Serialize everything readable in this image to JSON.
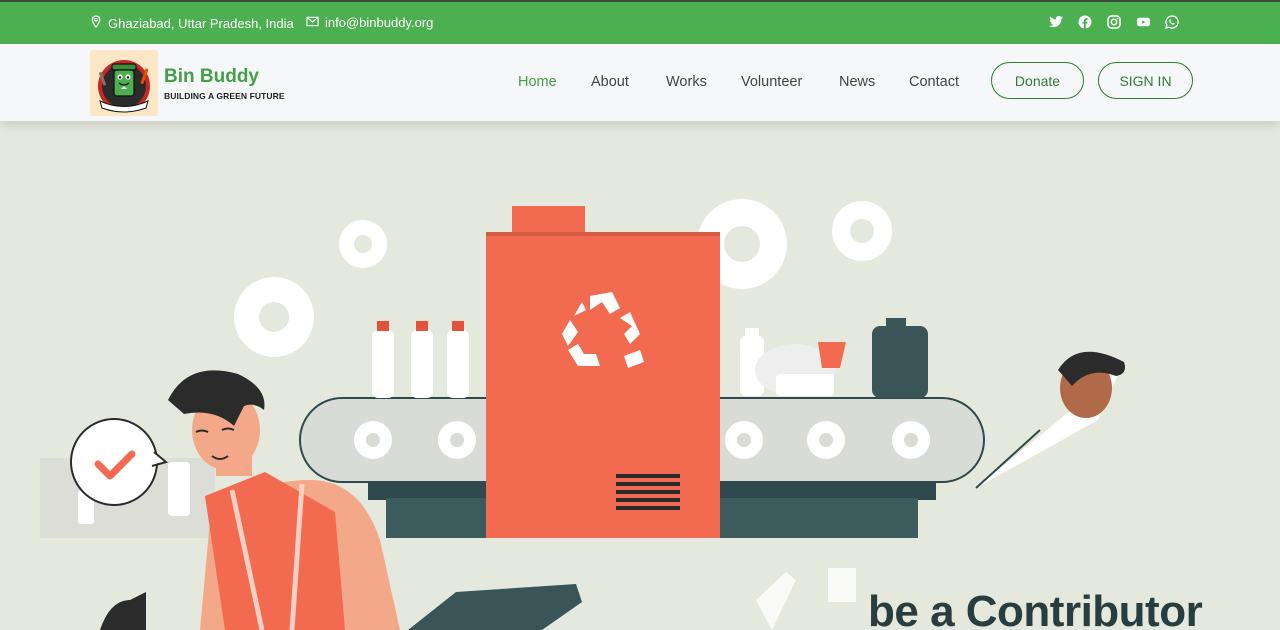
{
  "topbar": {
    "location": "Ghaziabad, Uttar Pradesh, India",
    "email": "info@binbuddy.org",
    "socials": [
      "twitter-icon",
      "facebook-icon",
      "instagram-icon",
      "youtube-icon",
      "whatsapp-icon"
    ]
  },
  "brand": {
    "name": "Bin Buddy",
    "tagline": "BUILDING A GREEN FUTURE",
    "logo_text": "BIN BUDDY"
  },
  "nav": {
    "items": [
      "Home",
      "About",
      "Works",
      "Volunteer",
      "News",
      "Contact"
    ],
    "active": "Home"
  },
  "buttons": {
    "donate": "Donate",
    "signin": "SIGN IN"
  },
  "hero": {
    "headline": "be a Contributor"
  },
  "colors": {
    "green": "#4caf50",
    "dark_green": "#2e7d32",
    "coral": "#f26b50",
    "hero_bg": "#e4e8dd",
    "dark_teal": "#3a5558"
  }
}
